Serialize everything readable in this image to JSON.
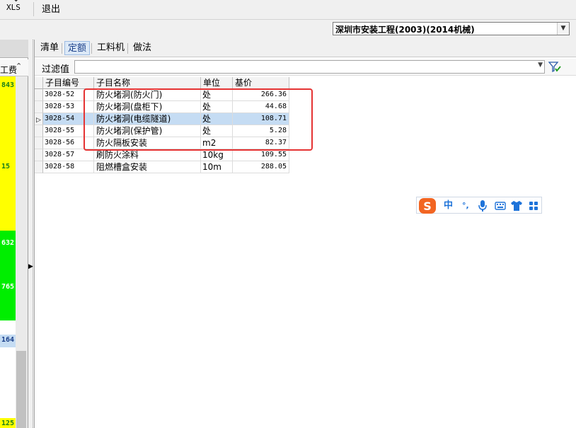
{
  "toolbar": {
    "xls_label": "XLS",
    "exit_label": "退出"
  },
  "quota_select": {
    "value": "深圳市安装工程(2003)(2014机械)"
  },
  "left_panel": {
    "column_header": "工费",
    "cells": [
      {
        "text": "843",
        "color": "#ffff00",
        "text_color": "#1a7f1a"
      },
      {
        "text": "15",
        "color": "#ffff00",
        "text_color": "#1a7f1a"
      },
      {
        "text": "632",
        "color": "#00ee00",
        "text_color": "#ffffff"
      },
      {
        "text": "765",
        "color": "#00ee00",
        "text_color": "#ffffff"
      },
      {
        "text": "164",
        "color": "#c5dcf3",
        "text_color": "#1a3f8a"
      },
      {
        "text": "125",
        "color": "#ffff00",
        "text_color": "#1a7f1a"
      }
    ]
  },
  "tabs": [
    {
      "label": "清单",
      "active": false
    },
    {
      "label": "定额",
      "active": true
    },
    {
      "label": "工料机",
      "active": false
    },
    {
      "label": "做法",
      "active": false
    }
  ],
  "filter": {
    "label": "过滤值",
    "value": ""
  },
  "grid": {
    "columns": [
      "子目编号",
      "子目名称",
      "单位",
      "基价"
    ],
    "rows": [
      {
        "code": "3028-52",
        "name": "防火堵洞(防火门)",
        "unit": "处",
        "price": "266.36",
        "selected": false
      },
      {
        "code": "3028-53",
        "name": "防火堵洞(盘柜下)",
        "unit": "处",
        "price": "44.68",
        "selected": false
      },
      {
        "code": "3028-54",
        "name": "防火堵洞(电缆隧道)",
        "unit": "处",
        "price": "108.71",
        "selected": true
      },
      {
        "code": "3028-55",
        "name": "防火堵洞(保护管)",
        "unit": "处",
        "price": "5.28",
        "selected": false
      },
      {
        "code": "3028-56",
        "name": "防火隔板安装",
        "unit": "m2",
        "price": "82.37",
        "selected": false
      },
      {
        "code": "3028-57",
        "name": "刷防火涂料",
        "unit": "10kg",
        "price": "109.55",
        "selected": false
      },
      {
        "code": "3028-58",
        "name": "阻燃槽盒安装",
        "unit": "10m",
        "price": "288.05",
        "selected": false
      }
    ]
  },
  "ime": {
    "lang": "中",
    "punct": "°,",
    "accent": "#1e73d9",
    "logo_color": "#f26522"
  }
}
